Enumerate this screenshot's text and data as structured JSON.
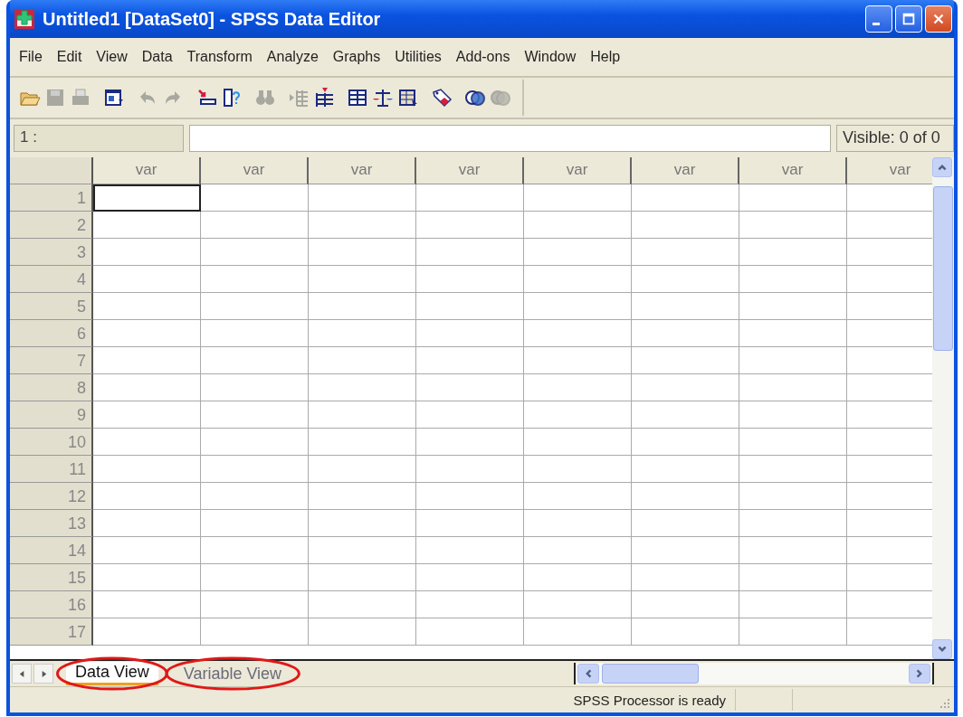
{
  "window": {
    "title": "Untitled1 [DataSet0] - SPSS Data Editor"
  },
  "menu": [
    "File",
    "Edit",
    "View",
    "Data",
    "Transform",
    "Analyze",
    "Graphs",
    "Utilities",
    "Add-ons",
    "Window",
    "Help"
  ],
  "toolbar": [
    {
      "kind": "open",
      "disabled": false
    },
    {
      "kind": "save",
      "disabled": true
    },
    {
      "kind": "print",
      "disabled": true
    },
    {
      "kind": "dialog",
      "disabled": false
    },
    {
      "kind": "undo",
      "disabled": true
    },
    {
      "kind": "redo",
      "disabled": true
    },
    {
      "kind": "goto",
      "disabled": false
    },
    {
      "kind": "variables",
      "disabled": false
    },
    {
      "kind": "find",
      "disabled": true
    },
    {
      "kind": "insert-case",
      "disabled": true
    },
    {
      "kind": "insert-variable",
      "disabled": false
    },
    {
      "kind": "split",
      "disabled": false
    },
    {
      "kind": "weight",
      "disabled": false
    },
    {
      "kind": "select",
      "disabled": false
    },
    {
      "kind": "labels",
      "disabled": false
    },
    {
      "kind": "sets",
      "disabled": false
    },
    {
      "kind": "sets",
      "disabled": true
    }
  ],
  "cell_editor": {
    "cell_label": "1 :",
    "visible": "Visible: 0 of 0"
  },
  "grid": {
    "columns": [
      "var",
      "var",
      "var",
      "var",
      "var",
      "var",
      "var",
      "var"
    ],
    "rows": [
      {
        "label": "1",
        "active": true
      },
      {
        "label": "2",
        "active": false
      },
      {
        "label": "3",
        "active": false
      },
      {
        "label": "4",
        "active": false
      },
      {
        "label": "5",
        "active": false
      },
      {
        "label": "6",
        "active": false
      },
      {
        "label": "7",
        "active": false
      },
      {
        "label": "8",
        "active": false
      },
      {
        "label": "9",
        "active": false
      },
      {
        "label": "10",
        "active": false
      },
      {
        "label": "11",
        "active": false
      },
      {
        "label": "12",
        "active": false
      },
      {
        "label": "13",
        "active": false
      },
      {
        "label": "14",
        "active": false
      },
      {
        "label": "15",
        "active": false
      },
      {
        "label": "16",
        "active": false
      },
      {
        "label": "17",
        "active": false
      }
    ]
  },
  "tabs": [
    {
      "label": "Data View",
      "selected": true
    },
    {
      "label": "Variable View",
      "selected": false
    }
  ],
  "status_bar": "SPSS Processor is ready"
}
